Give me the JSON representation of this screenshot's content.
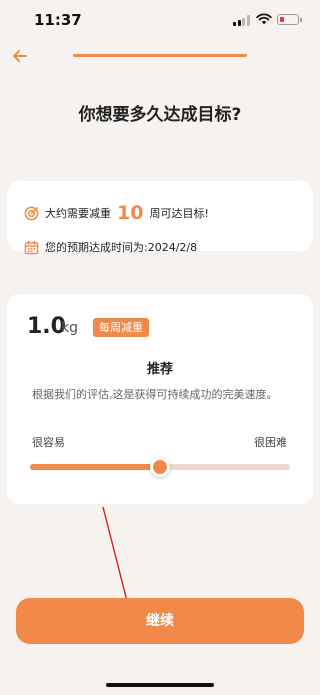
{
  "status_bar": {
    "time": "11:37",
    "signal_bars_filled": 2,
    "signal_bars_total": 4,
    "battery_level": 0.15
  },
  "header": {
    "back_icon": "arrow-left-icon",
    "progress": 1.0
  },
  "title": "你想要多久达成目标?",
  "estimate": {
    "line1_prefix": "大约需要减重",
    "weeks": "10",
    "line1_suffix": "周可达目标!",
    "line2": "您的预期达成时间为:2024/2/8",
    "icons": [
      "target-icon",
      "calendar-icon"
    ]
  },
  "pace": {
    "value": "1.0",
    "unit": "kg",
    "badge": "每周减重",
    "recommend_title": "推荐",
    "recommend_desc": "根据我们的评估,这是获得可持续成功的完美速度。",
    "easy_label": "很容易",
    "hard_label": "很困难",
    "slider_level": 0.5
  },
  "continue_label": "继续",
  "colors": {
    "accent": "#f0894a",
    "background": "#f6f2ef",
    "annotation_arrow": "#d62020"
  }
}
